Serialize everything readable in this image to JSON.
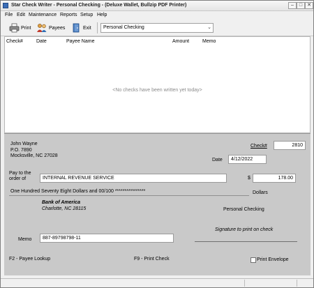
{
  "window": {
    "title": "Star Check Writer - Personal Checking - (Deluxe Wallet, Bullzip PDF Printer)"
  },
  "menu": [
    "File",
    "Edit",
    "Maintenance",
    "Reports",
    "Setup",
    "Help"
  ],
  "toolbar": {
    "print_label": "Print",
    "payees_label": "Payees",
    "exit_label": "Exit",
    "account_select": "Personal Checking"
  },
  "list": {
    "columns": [
      "Check#",
      "Date",
      "Payee Name",
      "Amount",
      "Memo"
    ],
    "empty_message": "<No checks have been written yet today>"
  },
  "check": {
    "owner_name": "John Wayne",
    "owner_address1": "P.O. 7890",
    "owner_address2": "Mocksville, NC  27028",
    "check_number_label": "Check#",
    "check_number": "2810",
    "date_label": "Date",
    "date": "4/12/2022",
    "pay_to_label1": "Pay to the",
    "pay_to_label2": "order of",
    "payee": "INTERNAL REVENUE SERVICE",
    "dollar_sign": "$",
    "amount": "178.00",
    "amount_words": "One Hundred Seventy Eight Dollars and 00/100 ****************",
    "dollars_label": "Dollars",
    "bank_name": "Bank of America",
    "bank_location": "Charlotte, NC 28115",
    "account_name": "Personal Checking",
    "signature_text": "Signature to print on check",
    "memo_label": "Memo",
    "memo": "887-89798798-11",
    "hint_lookup": "F2 - Payee Lookup",
    "hint_print": "F9 - Print Check",
    "print_envelope_label": "Print Envelope",
    "print_envelope_checked": false
  },
  "colors": {
    "check_background": "#c9c9c9",
    "window_background": "#f0f0f0"
  }
}
